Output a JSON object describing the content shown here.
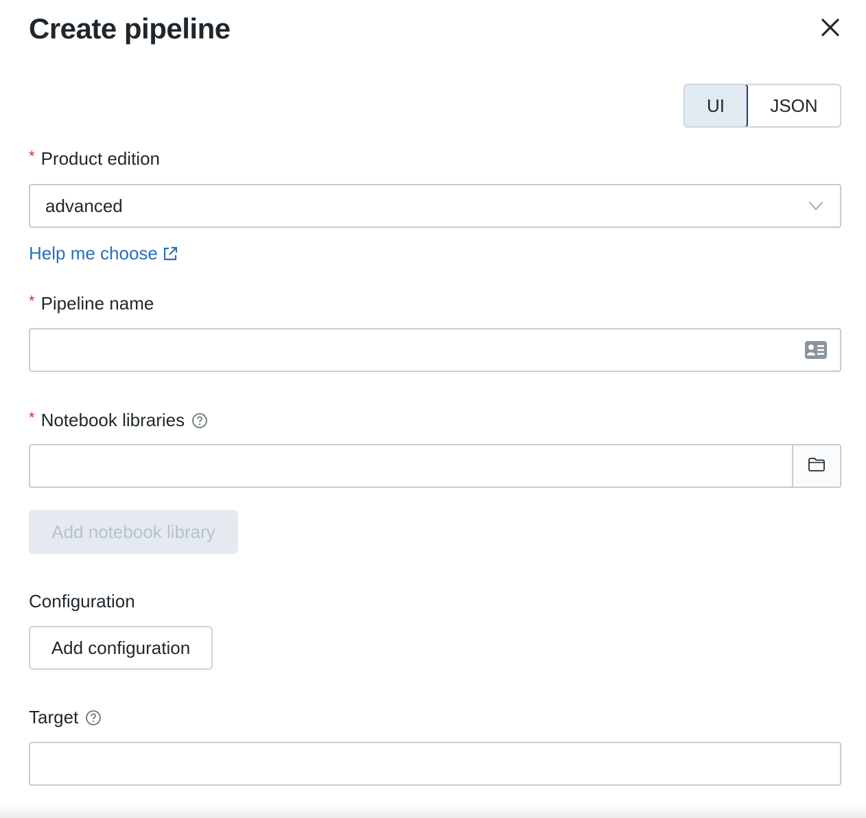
{
  "dialog": {
    "title": "Create pipeline"
  },
  "mode_toggle": {
    "options": [
      "UI",
      "JSON"
    ],
    "selected": "UI"
  },
  "product_edition": {
    "required_marker": "*",
    "label": "Product edition",
    "value": "advanced",
    "help_link": "Help me choose"
  },
  "pipeline_name": {
    "required_marker": "*",
    "label": "Pipeline name",
    "value": ""
  },
  "notebook_libraries": {
    "required_marker": "*",
    "label": "Notebook libraries",
    "value": "",
    "add_button": "Add notebook library"
  },
  "configuration": {
    "label": "Configuration",
    "add_button": "Add configuration"
  },
  "target": {
    "label": "Target",
    "value": ""
  },
  "icons": {
    "close": "close-icon",
    "dropdown": "chevron-down-icon",
    "external_link": "external-link-icon",
    "contact_card": "contact-card-icon",
    "help": "help-circle-icon",
    "folder": "folder-icon"
  },
  "colors": {
    "link": "#2a6fb5",
    "required": "#d93025",
    "toggle_selected_bg": "#e1e9f2",
    "toggle_selected_border": "#1e3a5c",
    "disabled_button_bg": "#e4eaf0",
    "disabled_button_text": "#b6c2cc"
  }
}
